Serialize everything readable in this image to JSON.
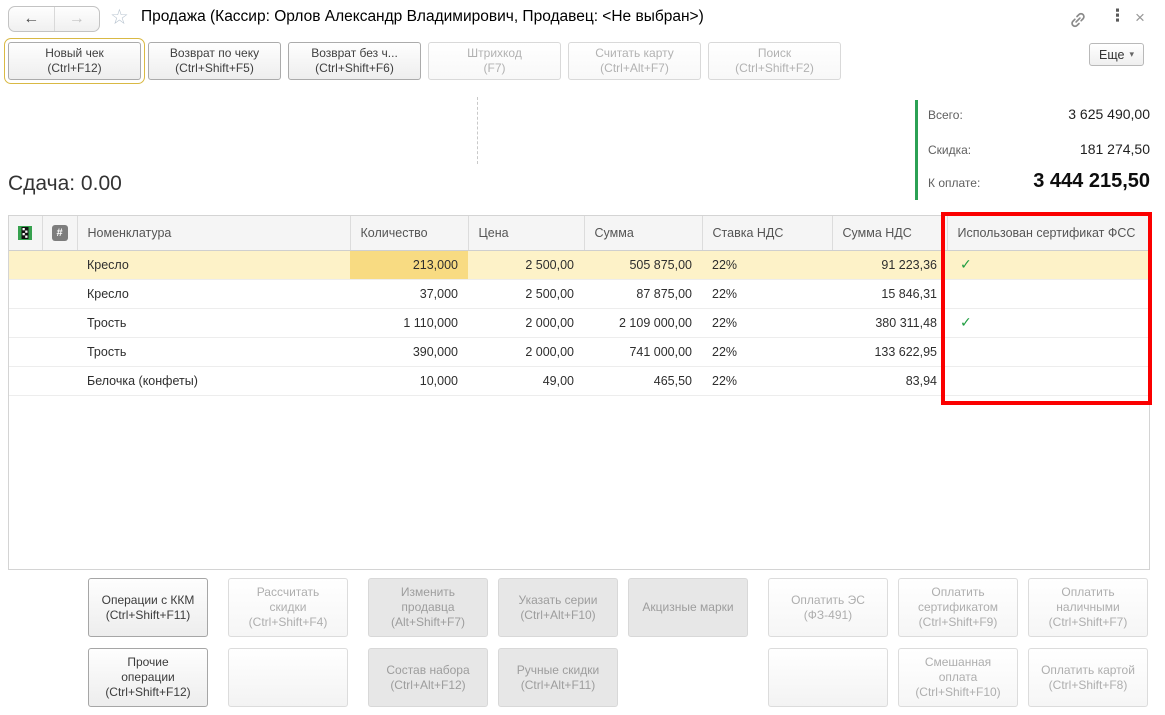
{
  "titlebar": {
    "title": "Продажа (Кассир: Орлов Александр Владимирович, Продавец: <Не выбран>)",
    "back_glyph": "←",
    "forward_glyph": "→",
    "star_glyph": "☆",
    "menu_glyph": "⋮",
    "close_glyph": "×",
    "link_icon": "link-icon"
  },
  "toolbar": {
    "buttons": [
      {
        "name": "new-receipt-button",
        "label": "Новый чек",
        "shortcut": "(Ctrl+F12)",
        "state": "enabled",
        "focused": true
      },
      {
        "name": "return-by-receipt-button",
        "label": "Возврат по чеку",
        "shortcut": "(Ctrl+Shift+F5)",
        "state": "enabled",
        "focused": false
      },
      {
        "name": "return-without-receipt-button",
        "label": "Возврат без ч...",
        "shortcut": "(Ctrl+Shift+F6)",
        "state": "enabled",
        "focused": false
      },
      {
        "name": "barcode-button",
        "label": "Штрихкод",
        "shortcut": "(F7)",
        "state": "disabled",
        "focused": false
      },
      {
        "name": "read-card-button",
        "label": "Считать карту",
        "shortcut": "(Ctrl+Alt+F7)",
        "state": "disabled",
        "focused": false
      },
      {
        "name": "search-button",
        "label": "Поиск",
        "shortcut": "(Ctrl+Shift+F2)",
        "state": "disabled",
        "focused": false
      }
    ],
    "more_label": "Еще",
    "more_arrow": "▾"
  },
  "summary": {
    "change_text": "Сдача: 0.00",
    "rows": [
      {
        "label": "Всего:",
        "value": "3 625 490,00",
        "strong": false
      },
      {
        "label": "Скидка:",
        "value": "181 274,50",
        "strong": false
      },
      {
        "label": "К оплате:",
        "value": "3 444 215,50",
        "strong": true
      }
    ],
    "accent_green": "#2ba154"
  },
  "table": {
    "header": {
      "marker_icon": "row-marker-icon",
      "number_glyph": "#",
      "name": "Номенклатура",
      "qty": "Количество",
      "price": "Цена",
      "sum": "Сумма",
      "vat_rate": "Ставка НДС",
      "vat_sum": "Сумма НДС",
      "fss": "Использован сертификат ФСС"
    },
    "check_glyph": "✓",
    "check_green": "#1f9d40",
    "annotation_red": "#fb0000",
    "selection_yellow": "#fdf2c8",
    "active_cell_yellow": "#f8db82",
    "rows": [
      {
        "name": "Кресло",
        "qty": "213,000",
        "price": "2 500,00",
        "sum": "505 875,00",
        "vat_rate": "22%",
        "vat_sum": "91 223,36",
        "fss": true,
        "selected": true
      },
      {
        "name": "Кресло",
        "qty": "37,000",
        "price": "2 500,00",
        "sum": "87 875,00",
        "vat_rate": "22%",
        "vat_sum": "15 846,31",
        "fss": false,
        "selected": false
      },
      {
        "name": "Трость",
        "qty": "1 110,000",
        "price": "2 000,00",
        "sum": "2 109 000,00",
        "vat_rate": "22%",
        "vat_sum": "380 311,48",
        "fss": true,
        "selected": false
      },
      {
        "name": "Трость",
        "qty": "390,000",
        "price": "2 000,00",
        "sum": "741 000,00",
        "vat_rate": "22%",
        "vat_sum": "133 622,95",
        "fss": false,
        "selected": false
      },
      {
        "name": "Белочка (конфеты)",
        "qty": "10,000",
        "price": "49,00",
        "sum": "465,50",
        "vat_rate": "22%",
        "vat_sum": "83,94",
        "fss": false,
        "selected": false
      }
    ]
  },
  "actions": {
    "row1": [
      {
        "name": "kkm-operations-button",
        "label": "Операции с ККМ",
        "shortcut": "(Ctrl+Shift+F11)",
        "state": "enabled"
      },
      {
        "name": "calculate-discounts-button",
        "label": "Рассчитать скидки",
        "shortcut": "(Ctrl+Shift+F4)",
        "state": "disabled"
      },
      {
        "name": "change-seller-button",
        "label": "Изменить продавца",
        "shortcut": "(Alt+Shift+F7)",
        "state": "gray"
      },
      {
        "name": "specify-series-button",
        "label": "Указать серии",
        "shortcut": "(Ctrl+Alt+F10)",
        "state": "gray"
      },
      {
        "name": "excise-stamps-button",
        "label": "Акцизные марки",
        "shortcut": "",
        "state": "gray"
      },
      {
        "name": "pay-es-button",
        "label": "Оплатить ЭС",
        "shortcut": "(ФЗ-491)",
        "state": "disabled"
      },
      {
        "name": "pay-certificate-button",
        "label": "Оплатить сертификатом",
        "shortcut": "(Ctrl+Shift+F9)",
        "state": "disabled"
      },
      {
        "name": "pay-cash-button",
        "label": "Оплатить наличными",
        "shortcut": "(Ctrl+Shift+F7)",
        "state": "disabled"
      }
    ],
    "row2": [
      {
        "name": "other-operations-button",
        "label": "Прочие операции",
        "shortcut": "(Ctrl+Shift+F12)",
        "state": "enabled"
      },
      {
        "name": "empty-button-1",
        "label": "",
        "shortcut": "",
        "state": "empty"
      },
      {
        "name": "set-contents-button",
        "label": "Состав набора",
        "shortcut": "(Ctrl+Alt+F12)",
        "state": "gray"
      },
      {
        "name": "manual-discounts-button",
        "label": "Ручные скидки",
        "shortcut": "(Ctrl+Alt+F11)",
        "state": "gray"
      },
      {
        "name": "spacer",
        "label": "",
        "shortcut": "",
        "state": "spacer"
      },
      {
        "name": "empty-button-2",
        "label": "",
        "shortcut": "",
        "state": "empty"
      },
      {
        "name": "mixed-payment-button",
        "label": "Смешанная оплата",
        "shortcut": "(Ctrl+Shift+F10)",
        "state": "disabled"
      },
      {
        "name": "pay-card-button",
        "label": "Оплатить картой",
        "shortcut": "(Ctrl+Shift+F8)",
        "state": "disabled"
      }
    ]
  }
}
